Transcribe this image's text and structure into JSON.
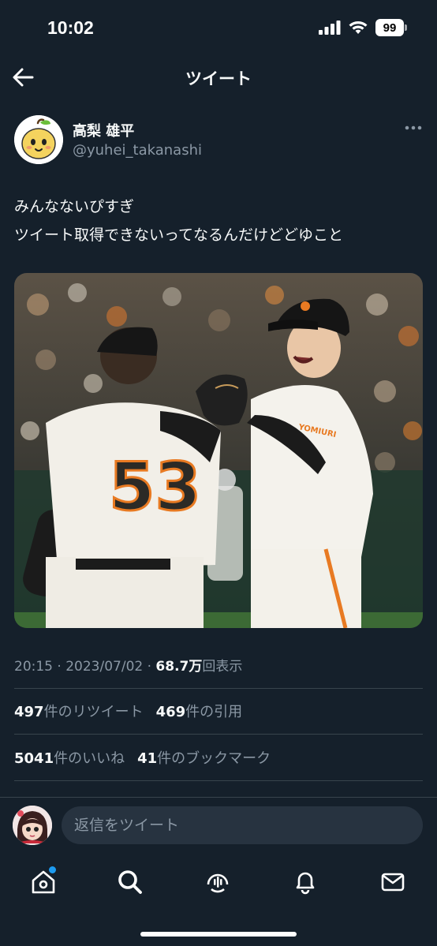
{
  "status_bar": {
    "time": "10:02",
    "battery": "99"
  },
  "nav": {
    "title": "ツイート"
  },
  "tweet": {
    "display_name": "高梨 雄平",
    "handle": "@yuhei_takanashi",
    "text_line1": "みんなないぴすぎ",
    "text_line2": "ツイート取得できないってなるんだけどどゆこと",
    "media": {
      "jersey_number": "53",
      "team_mark": "YOMIURI"
    }
  },
  "meta": {
    "time": "20:15",
    "sep1": "·",
    "date": "2023/07/02",
    "sep2": "·",
    "views_count": "68.7万",
    "views_label": "回表示"
  },
  "stats": {
    "retweets_count": "497",
    "retweets_label": "件のリツイート",
    "quotes_count": "469",
    "quotes_label": "件の引用",
    "likes_count": "5041",
    "likes_label": "件のいいね",
    "bookmarks_count": "41",
    "bookmarks_label": "件のブックマーク"
  },
  "reply": {
    "placeholder": "返信をツイート"
  },
  "tabs": [
    "home-icon",
    "search-icon",
    "spaces-icon",
    "notifications-icon",
    "messages-icon"
  ],
  "colors": {
    "background": "#15202b",
    "accent": "#1d9bf0",
    "secondary_text": "#8b98a5",
    "divider": "#38444d"
  }
}
